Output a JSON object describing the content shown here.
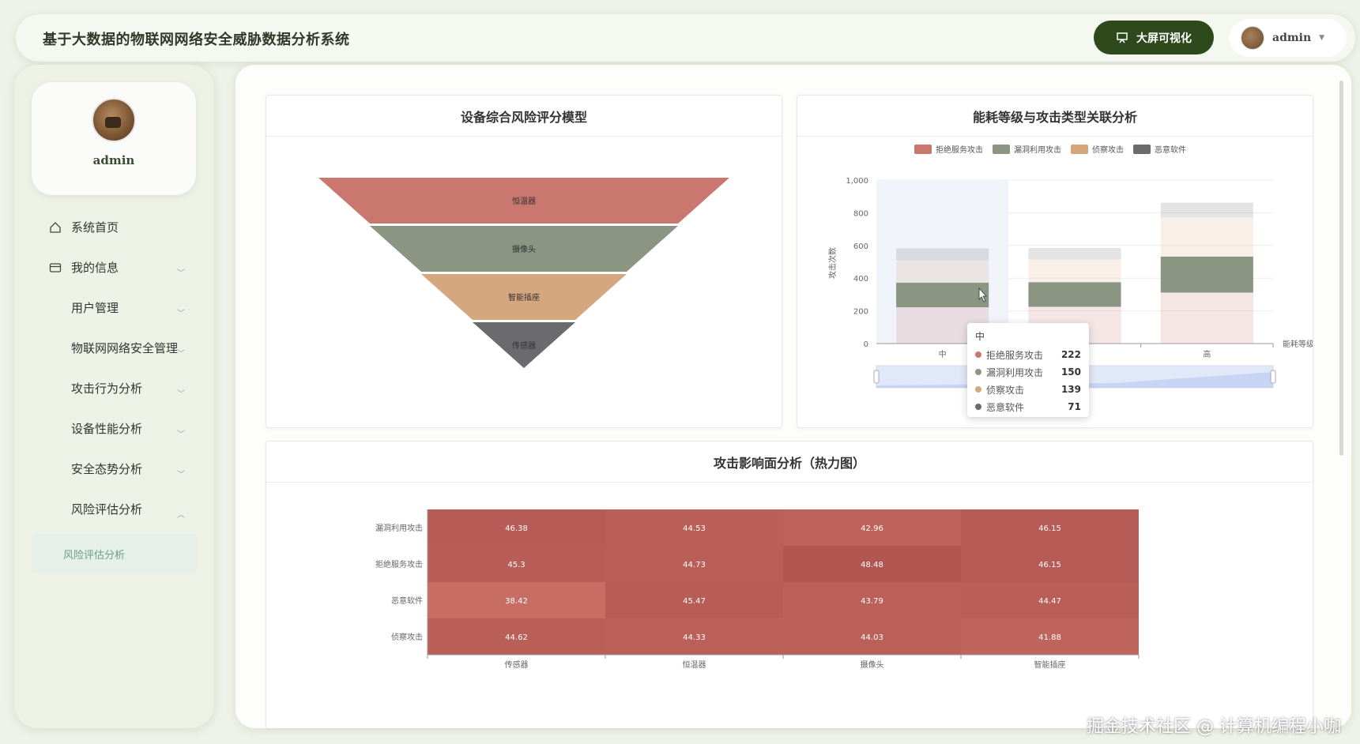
{
  "header": {
    "title": "基于大数据的物联网网络安全威胁数据分析系统",
    "big_screen_label": "大屏可视化",
    "user_name": "admin"
  },
  "sidebar": {
    "profile_name": "admin",
    "items": [
      {
        "label": "系统首页",
        "icon": "home-icon",
        "expandable": false
      },
      {
        "label": "我的信息",
        "icon": "card-icon",
        "expandable": true
      },
      {
        "label": "用户管理",
        "icon": "grid-icon",
        "expandable": true
      },
      {
        "label": "物联网网络安全管理",
        "icon": "grid-icon",
        "expandable": true
      },
      {
        "label": "攻击行为分析",
        "icon": "grid-icon",
        "expandable": true
      },
      {
        "label": "设备性能分析",
        "icon": "grid-icon",
        "expandable": true
      },
      {
        "label": "安全态势分析",
        "icon": "grid-icon",
        "expandable": true
      },
      {
        "label": "风险评估分析",
        "icon": "grid-icon",
        "expandable": true,
        "expanded": true
      }
    ],
    "submenu_active": "风险评估分析"
  },
  "colors": {
    "brand_dark_green": "#2e4a1c",
    "ddos": "#c9776f",
    "vuln": "#8a9582",
    "recon": "#d4a77e",
    "malware": "#6b6b6e"
  },
  "chart_data": [
    {
      "type": "funnel",
      "title": "设备综合风险评分模型",
      "categories": [
        "恒温器",
        "摄像头",
        "智能插座",
        "传感器"
      ]
    },
    {
      "type": "bar",
      "stacked": true,
      "title": "能耗等级与攻击类型关联分析",
      "categories": [
        "中",
        "低",
        "高"
      ],
      "xlabel": "能耗等级",
      "ylabel": "攻击次数",
      "ylim": [
        0,
        1000
      ],
      "yticks": [
        "0",
        "200",
        "400",
        "600",
        "800",
        "1,000"
      ],
      "xtick_labels": [
        "中",
        "",
        "高"
      ],
      "legend_position": "top",
      "series": [
        {
          "name": "拒绝服务攻击",
          "values": [
            222,
            225,
            312
          ]
        },
        {
          "name": "漏洞利用攻击",
          "values": [
            150,
            150,
            220
          ]
        },
        {
          "name": "侦察攻击",
          "values": [
            139,
            140,
            240
          ]
        },
        {
          "name": "恶意软件",
          "values": [
            71,
            70,
            90
          ]
        }
      ],
      "tooltip": {
        "category": "中",
        "rows": [
          {
            "name": "拒绝服务攻击",
            "value": "222"
          },
          {
            "name": "漏洞利用攻击",
            "value": "150"
          },
          {
            "name": "侦察攻击",
            "value": "139"
          },
          {
            "name": "恶意软件",
            "value": "71"
          }
        ]
      }
    },
    {
      "type": "heatmap",
      "title": "攻击影响面分析（热力图）",
      "x": [
        "传感器",
        "恒温器",
        "摄像头",
        "智能插座"
      ],
      "y": [
        "漏洞利用攻击",
        "拒绝服务攻击",
        "恶意软件",
        "侦察攻击"
      ],
      "values": [
        [
          "46.38",
          "44.53",
          "42.96",
          "46.15"
        ],
        [
          "45.3",
          "44.73",
          "48.48",
          "46.15"
        ],
        [
          "38.42",
          "45.47",
          "43.79",
          "44.47"
        ],
        [
          "44.62",
          "44.33",
          "44.03",
          "41.88"
        ]
      ]
    }
  ],
  "watermark": "掘金技术社区 @ 计算机编程小咖"
}
